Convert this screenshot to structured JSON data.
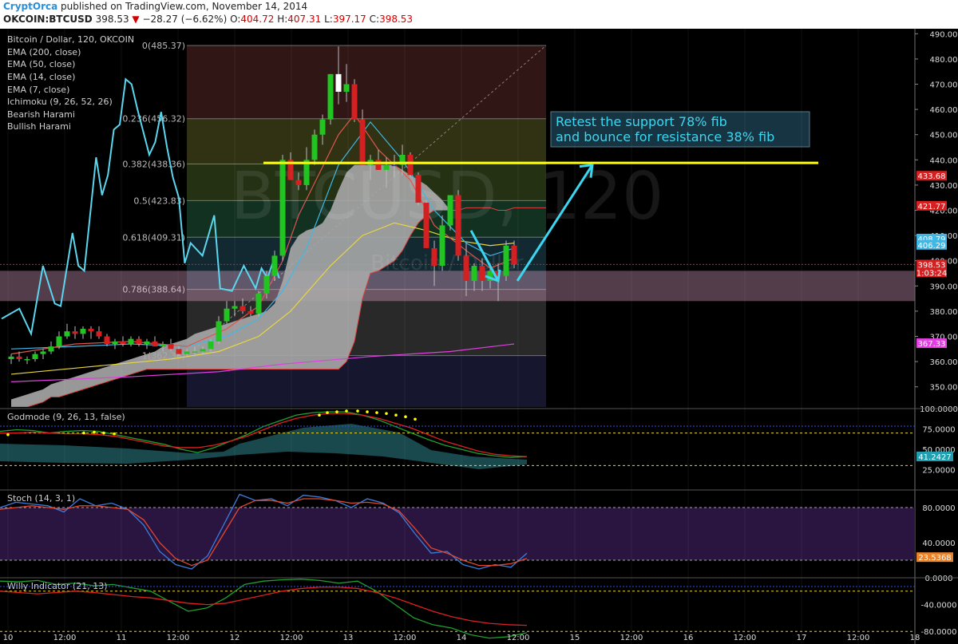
{
  "header": {
    "author": "CryptOrca",
    "published": "published on TradingView.com, November 14, 2014",
    "symbol": "OKCOIN:BTCUSD",
    "last": "398.53",
    "change": "−28.27 (−6.62%)",
    "o_label": "O:",
    "o": "404.72",
    "h_label": "H:",
    "h": "407.31",
    "l_label": "L:",
    "l": "397.17",
    "c_label": "C:",
    "c": "398.53"
  },
  "legend": {
    "title": "Bitcoin / Dollar, 120, OKCOIN",
    "studies": [
      "EMA (200, close)",
      "EMA (50, close)",
      "EMA (14, close)",
      "EMA (7, close)",
      "Ichimoku (9, 26, 52, 26)",
      "Bearish Harami",
      "Bullish Harami"
    ]
  },
  "watermark": {
    "symbol": "BTCUSD, 120",
    "name": "Bitcoin / Dollar"
  },
  "annotation": {
    "line1": "Retest the support 78% fib",
    "line2": "and bounce for resistance 38% fib"
  },
  "colors": {
    "up": "#22c422",
    "down": "#d42020",
    "ema7": "#e0554f",
    "ema14": "#3fb8e8",
    "ema50": "#e8d640",
    "ema200": "#e040e0",
    "sniper": "#5ad6ee",
    "annotation": "#3cd6f0",
    "resistance": "#ffff00"
  },
  "chart_data": [
    {
      "type": "candlestick",
      "title": "Bitcoin / Dollar, 120, OKCOIN",
      "ylim": [
        342,
        492
      ],
      "y_ticks": [
        350,
        360,
        370,
        380,
        390,
        400,
        410,
        420,
        430,
        440,
        450,
        460,
        470,
        480,
        490
      ],
      "x_ticks": [
        "10",
        "12:00",
        "11",
        "12:00",
        "12",
        "12:00",
        "13",
        "12:00",
        "14",
        "12:00",
        "15",
        "12:00",
        "16",
        "12:00",
        "17",
        "12:00",
        "18"
      ],
      "price_labels": [
        {
          "text": "433.68",
          "value": 433.7,
          "color": "#d42020"
        },
        {
          "text": "421.77",
          "value": 421.8,
          "color": "#d42020"
        },
        {
          "text": "408.79",
          "value": 408.8,
          "color": "#3fb8e8"
        },
        {
          "text": "406.29",
          "value": 406.3,
          "color": "#3fb8e8"
        },
        {
          "text": "398.53",
          "value": 398.5,
          "color": "#d42020"
        },
        {
          "text": "1:03:24",
          "value": 395.4,
          "color": "#d42020"
        },
        {
          "text": "367.33",
          "value": 367.3,
          "color": "#e040e0"
        }
      ],
      "fib_levels": [
        {
          "label": "0(485.37)",
          "value": 485.37
        },
        {
          "label": "0.236(456.32)",
          "value": 456.32
        },
        {
          "label": "0.382(438.36)",
          "value": 438.36
        },
        {
          "label": "0.5(423.83)",
          "value": 423.83
        },
        {
          "label": "0.618(409.31)",
          "value": 409.31
        },
        {
          "label": "0.786(388.64)",
          "value": 388.64
        },
        {
          "label": "1(362.36)",
          "value": 362.36
        }
      ],
      "resistance_line": 438.8,
      "support_zone": [
        384,
        396
      ],
      "candles": [
        [
          361,
          363,
          359,
          362
        ],
        [
          362,
          364,
          360,
          361
        ],
        [
          361,
          362,
          359,
          361
        ],
        [
          361,
          364,
          360,
          363
        ],
        [
          363,
          365,
          361,
          364
        ],
        [
          364,
          368,
          363,
          366
        ],
        [
          366,
          372,
          365,
          370
        ],
        [
          370,
          375,
          369,
          372
        ],
        [
          372,
          374,
          369,
          371
        ],
        [
          371,
          374,
          369,
          373
        ],
        [
          373,
          374,
          369,
          372
        ],
        [
          372,
          374,
          369,
          370
        ],
        [
          370,
          371,
          366,
          367
        ],
        [
          367,
          369,
          365,
          368
        ],
        [
          368,
          370,
          366,
          367
        ],
        [
          367,
          370,
          366,
          369
        ],
        [
          369,
          370,
          366,
          367
        ],
        [
          367,
          369,
          365,
          368
        ],
        [
          368,
          370,
          366,
          366
        ],
        [
          366,
          368,
          364,
          367
        ],
        [
          367,
          369,
          364,
          365
        ],
        [
          365,
          366,
          362,
          363
        ],
        [
          363,
          365,
          362,
          364
        ],
        [
          364,
          366,
          362,
          364
        ],
        [
          364,
          366,
          363,
          365
        ],
        [
          365,
          369,
          364,
          368
        ],
        [
          368,
          378,
          367,
          376
        ],
        [
          376,
          384,
          375,
          381
        ],
        [
          381,
          384,
          378,
          382
        ],
        [
          382,
          385,
          379,
          380
        ],
        [
          380,
          382,
          378,
          379
        ],
        [
          379,
          388,
          378,
          387
        ],
        [
          387,
          396,
          385,
          394
        ],
        [
          394,
          404,
          392,
          402
        ],
        [
          402,
          442,
          400,
          440
        ],
        [
          440,
          443,
          433,
          432
        ],
        [
          432,
          435,
          428,
          430
        ],
        [
          430,
          445,
          428,
          440
        ],
        [
          440,
          452,
          438,
          450
        ],
        [
          450,
          458,
          446,
          456
        ],
        [
          456,
          474,
          454,
          474
        ],
        [
          474,
          485,
          462,
          467
        ],
        [
          467,
          478,
          463,
          470
        ],
        [
          470,
          472,
          455,
          456
        ],
        [
          456,
          460,
          440,
          438
        ],
        [
          438,
          442,
          432,
          440
        ],
        [
          440,
          444,
          436,
          436
        ],
        [
          436,
          441,
          429,
          438
        ],
        [
          438,
          442,
          433,
          438
        ],
        [
          438,
          446,
          434,
          442
        ],
        [
          442,
          443,
          433,
          434
        ],
        [
          434,
          435,
          422,
          423
        ],
        [
          423,
          424,
          405,
          405
        ],
        [
          405,
          408,
          390,
          398
        ],
        [
          398,
          418,
          396,
          414
        ],
        [
          414,
          426,
          412,
          426
        ],
        [
          426,
          428,
          400,
          402
        ],
        [
          402,
          407,
          386,
          392
        ],
        [
          392,
          399,
          388,
          398
        ],
        [
          398,
          401,
          388,
          392
        ],
        [
          392,
          399,
          389,
          396
        ],
        [
          396,
          399,
          384,
          394
        ],
        [
          394,
          408,
          392,
          406
        ],
        [
          406,
          408,
          397,
          398.53
        ]
      ],
      "ema7": [
        [
          0,
          363
        ],
        [
          8,
          367
        ],
        [
          15,
          368
        ],
        [
          22,
          366
        ],
        [
          27,
          373
        ],
        [
          31,
          382
        ],
        [
          34,
          400
        ],
        [
          36,
          418
        ],
        [
          41,
          450
        ],
        [
          43,
          458
        ],
        [
          46,
          444
        ],
        [
          50,
          432
        ],
        [
          53,
          414
        ],
        [
          57,
          404
        ],
        [
          60,
          397
        ],
        [
          63,
          401
        ]
      ],
      "ema14": [
        [
          0,
          365
        ],
        [
          8,
          366
        ],
        [
          15,
          367
        ],
        [
          22,
          366
        ],
        [
          27,
          370
        ],
        [
          31,
          377
        ],
        [
          34,
          388
        ],
        [
          37,
          405
        ],
        [
          41,
          438
        ],
        [
          45,
          455
        ],
        [
          49,
          440
        ],
        [
          53,
          420
        ],
        [
          57,
          407
        ],
        [
          60,
          402
        ],
        [
          63,
          405
        ]
      ],
      "ema50": [
        [
          0,
          355
        ],
        [
          10,
          358
        ],
        [
          20,
          361
        ],
        [
          26,
          364
        ],
        [
          31,
          370
        ],
        [
          35,
          380
        ],
        [
          40,
          398
        ],
        [
          44,
          410
        ],
        [
          48,
          415
        ],
        [
          52,
          412
        ],
        [
          56,
          408
        ],
        [
          60,
          406
        ],
        [
          63,
          407
        ]
      ],
      "ema200": [
        [
          0,
          352
        ],
        [
          15,
          354
        ],
        [
          26,
          356
        ],
        [
          34,
          359
        ],
        [
          45,
          362
        ],
        [
          55,
          364
        ],
        [
          63,
          367
        ]
      ],
      "sniper": [
        [
          0,
          377
        ],
        [
          3,
          381
        ],
        [
          5,
          371
        ],
        [
          7,
          398
        ],
        [
          9,
          383
        ],
        [
          10,
          382
        ],
        [
          12,
          411
        ],
        [
          13,
          398
        ],
        [
          14,
          396
        ],
        [
          16,
          441
        ],
        [
          17,
          426
        ],
        [
          18,
          434
        ],
        [
          19,
          452
        ],
        [
          20,
          454
        ],
        [
          21,
          472
        ],
        [
          22,
          470
        ],
        [
          23,
          460
        ],
        [
          25,
          442
        ],
        [
          26,
          447
        ],
        [
          27,
          459
        ],
        [
          28,
          445
        ],
        [
          29,
          433
        ],
        [
          30,
          425
        ],
        [
          31,
          399
        ],
        [
          32,
          407
        ],
        [
          34,
          402
        ],
        [
          36,
          418
        ],
        [
          37,
          389
        ],
        [
          39,
          388
        ],
        [
          41,
          398
        ],
        [
          43,
          389
        ],
        [
          44,
          397
        ],
        [
          45,
          393
        ],
        [
          46,
          400
        ],
        [
          47,
          393
        ]
      ],
      "ichimoku": {
        "x0": 32,
        "upper": [
          345,
          346,
          347,
          348,
          349,
          351,
          352,
          353,
          354,
          355,
          356,
          357,
          358,
          359,
          360,
          361,
          362,
          363,
          364,
          366,
          367,
          368,
          369,
          371,
          372,
          373,
          374,
          375,
          376,
          377,
          378,
          379,
          380,
          383,
          392,
          405,
          410,
          412,
          413,
          415,
          420,
          428,
          435,
          438,
          438,
          438,
          438,
          438,
          438,
          436,
          434,
          432,
          430,
          427,
          424,
          420,
          420,
          421,
          421,
          421,
          421,
          420,
          420,
          421,
          421,
          421,
          421,
          421
        ],
        "lower": [
          342,
          342,
          342,
          343,
          344,
          346,
          346,
          347,
          348,
          349,
          350,
          351,
          352,
          353,
          354,
          355,
          356,
          357,
          357,
          357,
          357,
          357,
          357,
          357,
          357,
          357,
          357,
          357,
          357,
          357,
          357,
          357,
          357,
          357,
          357,
          357,
          357,
          357,
          357,
          357,
          357,
          357,
          360,
          368,
          385,
          395,
          396,
          398,
          400,
          404,
          410,
          415,
          418,
          420,
          420,
          420,
          420,
          421,
          421,
          421,
          421,
          420,
          420,
          421,
          421,
          421,
          421,
          421
        ]
      }
    },
    {
      "type": "line",
      "title": "Godmode (9, 26, 13, false)",
      "ylim": [
        0,
        100
      ],
      "y_ticks": [
        "100.0000",
        "75.0000",
        "50.0000",
        "25.0000"
      ],
      "last_label": "41.2427",
      "levels": [
        70,
        30
      ],
      "series": [
        {
          "values": [
            72,
            74,
            73,
            70,
            72,
            73,
            72,
            68,
            64,
            60,
            56,
            50,
            46,
            52,
            60,
            68,
            78,
            85,
            92,
            95,
            96,
            96,
            92,
            86,
            78,
            70,
            62,
            55,
            50,
            45,
            42,
            40,
            41
          ]
        },
        {
          "values": [
            70,
            70,
            71,
            70,
            69,
            69,
            68,
            66,
            62,
            58,
            54,
            52,
            52,
            55,
            60,
            66,
            74,
            82,
            88,
            92,
            94,
            94,
            92,
            88,
            82,
            76,
            68,
            60,
            54,
            48,
            44,
            42,
            41
          ]
        }
      ]
    },
    {
      "type": "line",
      "title": "Stoch (14, 3, 1)",
      "ylim": [
        0,
        100
      ],
      "y_ticks": [
        "80.0000",
        "40.0000"
      ],
      "last_label": "23.5368",
      "levels": [
        80,
        20
      ],
      "series": [
        {
          "values": [
            80,
            86,
            84,
            82,
            75,
            90,
            82,
            85,
            78,
            60,
            30,
            15,
            10,
            25,
            60,
            95,
            88,
            90,
            82,
            94,
            92,
            88,
            80,
            90,
            85,
            74,
            50,
            28,
            30,
            15,
            10,
            15,
            12,
            28
          ]
        },
        {
          "values": [
            78,
            80,
            82,
            80,
            78,
            82,
            82,
            80,
            78,
            66,
            40,
            22,
            14,
            20,
            50,
            80,
            88,
            88,
            85,
            90,
            90,
            88,
            85,
            86,
            84,
            76,
            56,
            34,
            28,
            20,
            14,
            14,
            16,
            22
          ]
        }
      ]
    },
    {
      "type": "line",
      "title": "Willy Indicator (21, 13)",
      "ylim": [
        -100,
        0
      ],
      "y_ticks": [
        "0.0000",
        "-40.0000",
        "-80.0000"
      ],
      "levels": [
        -20,
        -80
      ],
      "series": [
        {
          "values": [
            -5,
            -6,
            -4,
            -10,
            -8,
            -12,
            -10,
            -15,
            -20,
            -35,
            -50,
            -45,
            -30,
            -10,
            -5,
            -3,
            -2,
            -4,
            -8,
            -5,
            -20,
            -40,
            -60,
            -70,
            -75,
            -85,
            -90,
            -88,
            -82
          ]
        },
        {
          "values": [
            -20,
            -22,
            -24,
            -22,
            -20,
            -22,
            -25,
            -28,
            -30,
            -34,
            -38,
            -40,
            -38,
            -32,
            -26,
            -20,
            -16,
            -14,
            -14,
            -16,
            -22,
            -30,
            -40,
            -50,
            -58,
            -64,
            -68,
            -70,
            -71
          ]
        }
      ]
    }
  ]
}
